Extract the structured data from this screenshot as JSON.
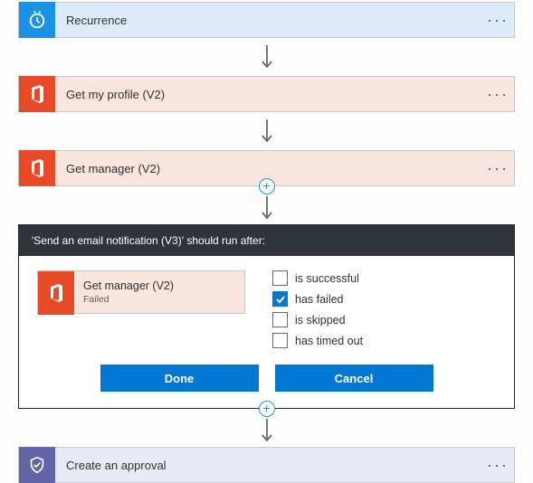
{
  "steps": {
    "recurrence": {
      "title": "Recurrence"
    },
    "profile": {
      "title": "Get my profile (V2)"
    },
    "manager": {
      "title": "Get manager (V2)"
    },
    "approval": {
      "title": "Create an approval"
    }
  },
  "panel": {
    "heading": "'Send an email notification (V3)' should run after:",
    "card": {
      "title": "Get manager (V2)",
      "status": "Failed"
    },
    "options": {
      "successful": {
        "label": "is successful",
        "checked": false
      },
      "failed": {
        "label": "has failed",
        "checked": true
      },
      "skipped": {
        "label": "is skipped",
        "checked": false
      },
      "timedout": {
        "label": "has timed out",
        "checked": false
      }
    },
    "buttons": {
      "done": "Done",
      "cancel": "Cancel"
    }
  },
  "ui": {
    "menu_glyph": "···",
    "plus_glyph": "+"
  },
  "colors": {
    "accent": "#0078d4",
    "orange": "#e84a27"
  }
}
